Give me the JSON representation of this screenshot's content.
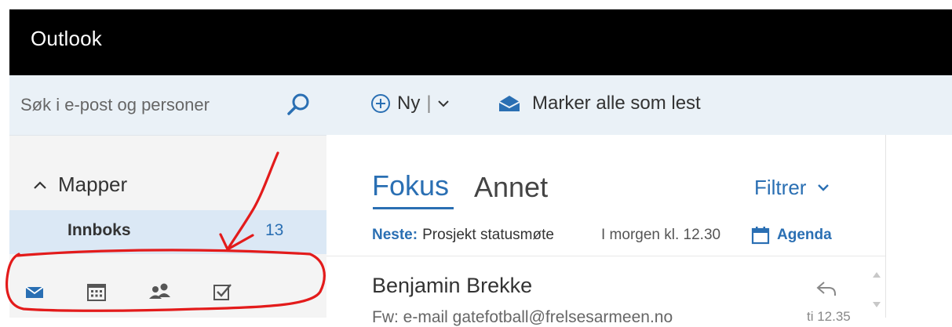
{
  "app": {
    "title": "Outlook"
  },
  "search": {
    "placeholder": "Søk i e-post og personer",
    "icon": "search-icon"
  },
  "toolbar": {
    "new_label": "Ny",
    "new_separator": "|",
    "mark_all_read": "Marker alle som lest"
  },
  "sidebar": {
    "folders_header": "Mapper",
    "inbox": {
      "label": "Innboks",
      "count": "13"
    },
    "modules": [
      {
        "name": "mail",
        "icon": "mail-icon"
      },
      {
        "name": "calendar",
        "icon": "calendar-icon"
      },
      {
        "name": "people",
        "icon": "people-icon"
      },
      {
        "name": "tasks",
        "icon": "tasks-icon"
      }
    ]
  },
  "list": {
    "tabs": {
      "focused": "Fokus",
      "other": "Annet"
    },
    "filter": "Filtrer",
    "next": {
      "label": "Neste:",
      "subject": "Prosjekt statusmøte",
      "time": "I morgen kl. 12.30",
      "agenda": "Agenda"
    },
    "messages": [
      {
        "sender": "Benjamin Brekke",
        "preview": "Fw: e-mail gatefotball@frelsesarmeen.no",
        "time": "ti 12.35"
      }
    ]
  },
  "colors": {
    "accent": "#2a6fb3",
    "topbar": "#000000",
    "selected": "#dbe8f5",
    "annotation": "#e31b1b"
  }
}
